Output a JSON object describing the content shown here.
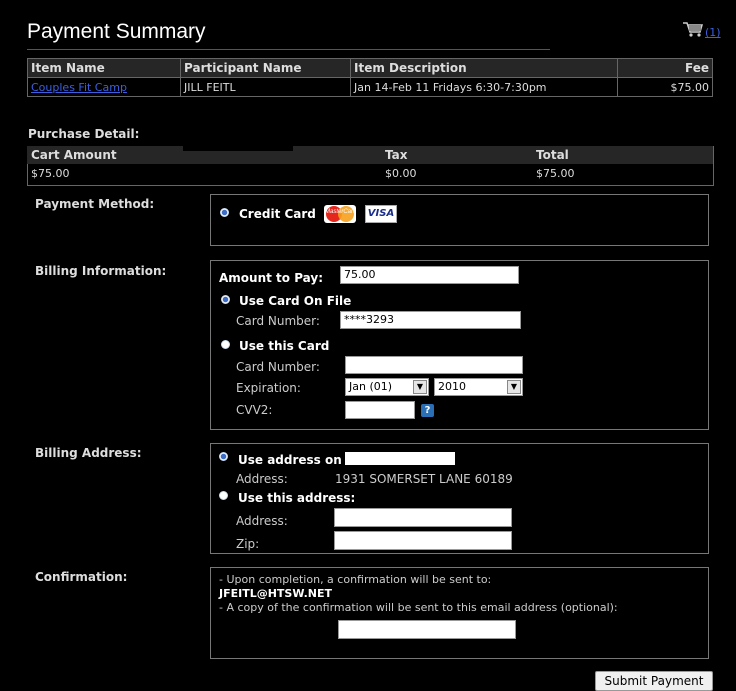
{
  "header": {
    "title": "Payment Summary",
    "cart_count": "(1)"
  },
  "items_table": {
    "columns": [
      "Item Name",
      "Participant Name",
      "Item Description",
      "Fee"
    ],
    "rows": [
      {
        "item_name": "Couples Fit Camp",
        "participant": "JILL FEITL",
        "description": "Jan 14-Feb 11 Fridays 6:30-7:30pm",
        "fee": "$75.00"
      }
    ]
  },
  "purchase_detail": {
    "label": "Purchase Detail:",
    "columns": [
      "Cart Amount",
      "Tax",
      "Total"
    ],
    "values": [
      "$75.00",
      "$0.00",
      "$75.00"
    ]
  },
  "payment_method": {
    "label": "Payment Method:",
    "option": "Credit Card",
    "card_logos": [
      "mastercard-icon",
      "visa-icon"
    ],
    "visa_text": "VISA",
    "mc_text": "MasterCard"
  },
  "billing_info": {
    "label": "Billing Information:",
    "amount_label": "Amount to Pay:",
    "amount_value": "75.00",
    "use_card_on_file": "Use Card On File",
    "card_number_label": "Card Number:",
    "card_on_file_value": "****3293",
    "use_this_card": "Use this Card",
    "new_card_number_label": "Card Number:",
    "expiration_label": "Expiration:",
    "exp_month": "Jan (01)",
    "exp_year": "2010",
    "cvv_label": "CVV2:",
    "help": "?"
  },
  "billing_address": {
    "label": "Billing Address:",
    "use_address_on": "Use address on",
    "address_label": "Address:",
    "address_value": "1931 SOMERSET LANE 60189",
    "use_this_address": "Use this address:",
    "new_address_label": "Address:",
    "zip_label": "Zip:"
  },
  "confirmation": {
    "label": "Confirmation:",
    "line1": "- Upon completion, a confirmation will be sent to:",
    "email": "JFEITL@HTSW.NET",
    "line2": "- A copy of the confirmation will be sent to this email address (optional):"
  },
  "submit_label": "Submit Payment"
}
